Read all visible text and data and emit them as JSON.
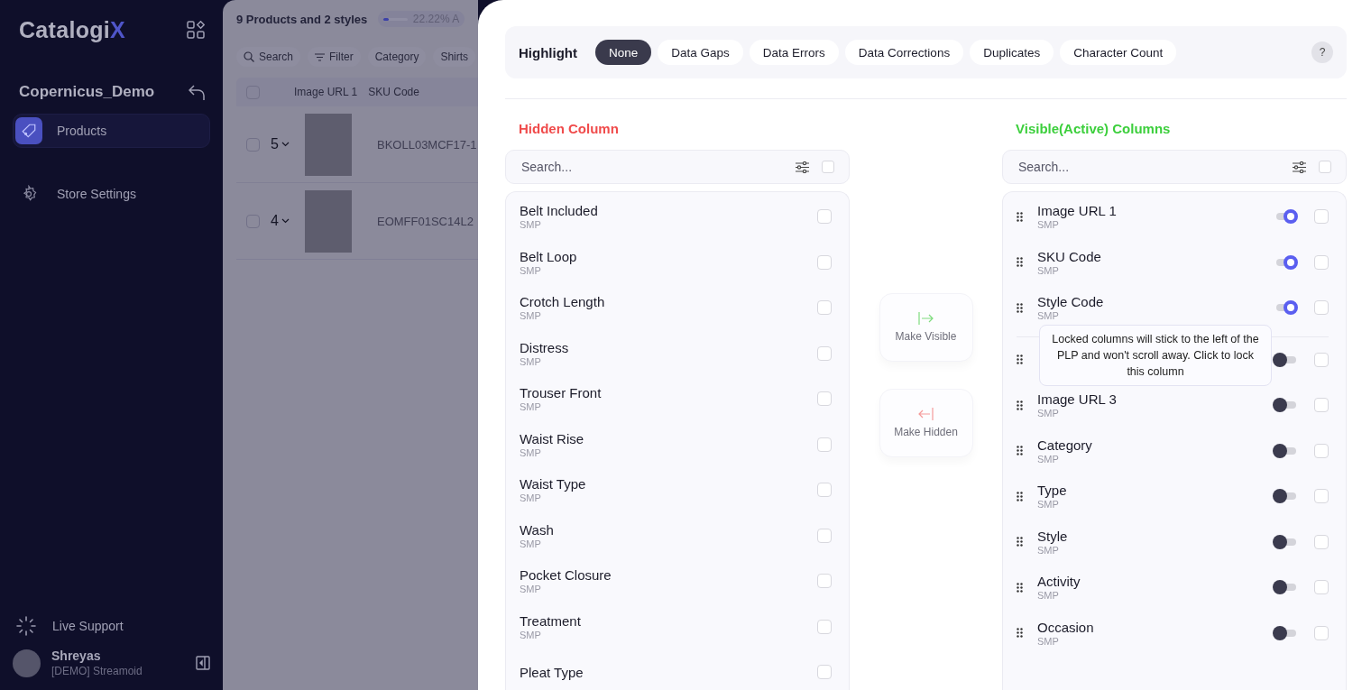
{
  "sidebar": {
    "logo": "Catalogi",
    "logo_accent": "X",
    "workspace": "Copernicus_Demo",
    "items": [
      {
        "label": "Products",
        "selected": true,
        "kind": "tag"
      },
      {
        "label": "Store Settings",
        "selected": false,
        "kind": "gear"
      }
    ],
    "support": "Live Support",
    "user": {
      "name": "Shreyas",
      "org": "[DEMO] Streamoid"
    }
  },
  "background": {
    "title": "9 Products and 2 styles",
    "progress": {
      "level": 0.22,
      "reading": "22.22% A"
    },
    "toolbar": {
      "search": "Search",
      "filter": "Filter",
      "chips": [
        "Category",
        "Shirts"
      ]
    },
    "columns": [
      "Image URL 1",
      "SKU Code"
    ],
    "all_checked": false,
    "rows": [
      {
        "count": "5",
        "sku": "BKOLL03MCF17-1",
        "checked": false
      },
      {
        "count": "4",
        "sku": "EOMFF01SC14L2",
        "checked": false
      }
    ]
  },
  "highlight": {
    "title": "Highlight",
    "options": [
      {
        "label": "None",
        "selected": true
      },
      {
        "label": "Data Gaps",
        "selected": false
      },
      {
        "label": "Data Errors",
        "selected": false
      },
      {
        "label": "Data Corrections",
        "selected": false
      },
      {
        "label": "Duplicates",
        "selected": false
      },
      {
        "label": "Character Count",
        "selected": false
      }
    ],
    "help": "?"
  },
  "hidden": {
    "title": "Hidden Column",
    "placeholder": "Search...",
    "all_checked": false,
    "items": [
      {
        "name": "Belt Included",
        "source": "SMP",
        "checked": false
      },
      {
        "name": "Belt Loop",
        "source": "SMP",
        "checked": false
      },
      {
        "name": "Crotch Length",
        "source": "SMP",
        "checked": false
      },
      {
        "name": "Distress",
        "source": "SMP",
        "checked": false
      },
      {
        "name": "Trouser Front",
        "source": "SMP",
        "checked": false
      },
      {
        "name": "Waist Rise",
        "source": "SMP",
        "checked": false
      },
      {
        "name": "Waist Type",
        "source": "SMP",
        "checked": false
      },
      {
        "name": "Wash",
        "source": "SMP",
        "checked": false
      },
      {
        "name": "Pocket Closure",
        "source": "SMP",
        "checked": false
      },
      {
        "name": "Treatment",
        "source": "SMP",
        "checked": false
      },
      {
        "name": "Pleat Type",
        "checked": false
      }
    ]
  },
  "actions": [
    {
      "label": "Make Visible",
      "kind": "visible"
    },
    {
      "label": "Make Hidden",
      "kind": "hidden"
    }
  ],
  "visible": {
    "title": "Visible(Active) Columns",
    "placeholder": "Search...",
    "all_checked": false,
    "items": [
      {
        "name": "Image URL 1",
        "source": "SMP",
        "locked": true,
        "checked": false
      },
      {
        "name": "SKU Code",
        "source": "SMP",
        "locked": true,
        "checked": false
      },
      {
        "name": "Style Code",
        "source": "SMP",
        "locked": true,
        "checked": false
      },
      {
        "locked": false,
        "checked": false,
        "tooltip": "Locked columns will stick to the left of the PLP and won't scroll away. Click to lock this column"
      },
      {
        "name": "Image URL 3",
        "source": "SMP",
        "locked": false,
        "checked": false
      },
      {
        "name": "Category",
        "source": "SMP",
        "locked": false,
        "checked": false
      },
      {
        "name": "Type",
        "source": "SMP",
        "locked": false,
        "checked": false
      },
      {
        "name": "Style",
        "source": "SMP",
        "locked": false,
        "checked": false
      },
      {
        "name": "Activity",
        "source": "SMP",
        "locked": false,
        "checked": false
      },
      {
        "name": "Occasion",
        "source": "SMP",
        "locked": false,
        "checked": false
      }
    ]
  }
}
